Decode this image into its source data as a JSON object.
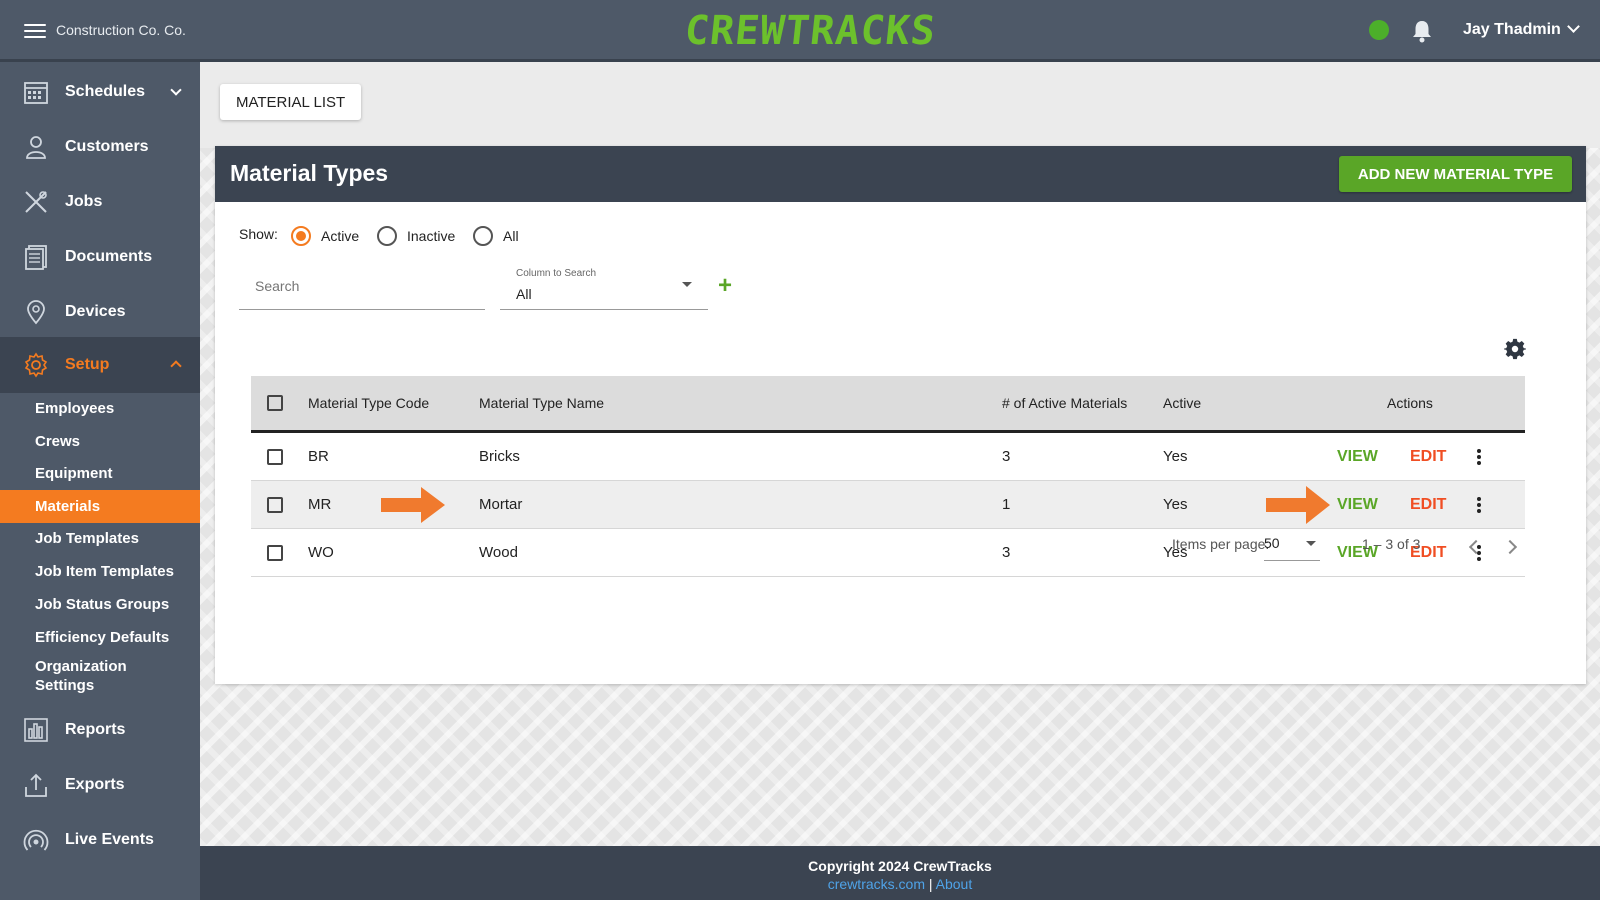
{
  "header": {
    "company": "Construction Co. Co.",
    "logo": "CREWTRACKS",
    "user": "Jay Thadmin",
    "status_color": "#4caf2a"
  },
  "sidebar": {
    "items": [
      {
        "label": "Schedules",
        "icon": "calendar-icon"
      },
      {
        "label": "Customers",
        "icon": "customer-icon"
      },
      {
        "label": "Jobs",
        "icon": "tools-icon"
      },
      {
        "label": "Documents",
        "icon": "documents-icon"
      },
      {
        "label": "Devices",
        "icon": "location-pin-icon"
      },
      {
        "label": "Setup",
        "icon": "gear-icon"
      },
      {
        "label": "Reports",
        "icon": "bar-chart-icon"
      },
      {
        "label": "Exports",
        "icon": "upload-icon"
      },
      {
        "label": "Live Events",
        "icon": "broadcast-icon"
      }
    ],
    "setup_subitems": [
      "Employees",
      "Crews",
      "Equipment",
      "Materials",
      "Job Templates",
      "Job Item Templates",
      "Job Status Groups",
      "Efficiency Defaults",
      "Organization Settings"
    ],
    "active_subitem": "Materials"
  },
  "main": {
    "tab_label": "MATERIAL LIST",
    "card_title": "Material Types",
    "add_button": "ADD NEW MATERIAL TYPE",
    "show_label": "Show:",
    "filters": [
      {
        "label": "Active",
        "checked": true
      },
      {
        "label": "Inactive",
        "checked": false
      },
      {
        "label": "All",
        "checked": false
      }
    ],
    "search_placeholder": "Search",
    "column_select_label": "Column to Search",
    "column_select_value": "All"
  },
  "table": {
    "headers": [
      "Material Type Code",
      "Material Type Name",
      "# of Active Materials",
      "Active",
      "Actions"
    ],
    "rows": [
      {
        "code": "BR",
        "name": "Bricks",
        "count": "3",
        "active": "Yes"
      },
      {
        "code": "MR",
        "name": "Mortar",
        "count": "1",
        "active": "Yes"
      },
      {
        "code": "WO",
        "name": "Wood",
        "count": "3",
        "active": "Yes"
      }
    ],
    "view_label": "VIEW",
    "edit_label": "EDIT"
  },
  "paginator": {
    "label": "Items per page:",
    "per_page": "50",
    "range": "1 – 3 of 3"
  },
  "footer": {
    "copyright": "Copyright 2024 CrewTracks",
    "link1": "crewtracks.com",
    "separator": "|",
    "link2": "About"
  },
  "colors": {
    "accent_orange": "#f47b20",
    "brand_green": "#5aa627",
    "edit_red": "#f04e23",
    "header_bg": "#4e5968"
  }
}
